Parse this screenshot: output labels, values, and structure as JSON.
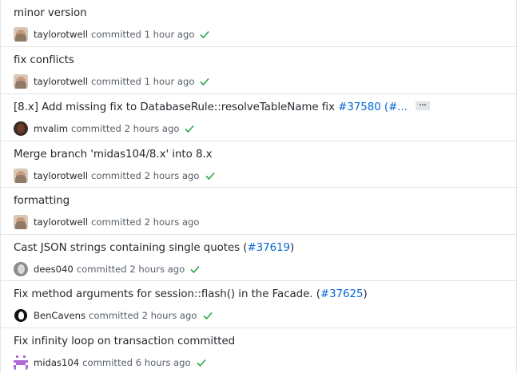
{
  "colors": {
    "check": "#28a745",
    "link": "#0366d6",
    "border": "#e1e4e8",
    "meta_text": "#586069"
  },
  "commits": [
    {
      "title": "minor version",
      "author": "taylorotwell",
      "committed_label": "committed",
      "time": "1 hour ago",
      "avatar": "taylorotwell-avatar",
      "status": "success"
    },
    {
      "title": "fix conflicts",
      "author": "taylorotwell",
      "committed_label": "committed",
      "time": "1 hour ago",
      "avatar": "taylorotwell-avatar",
      "status": "success"
    },
    {
      "title_prefix": "[8.x] Add missing fix to DatabaseRule::resolveTableName fix ",
      "issue_link": "#37580",
      "title_suffix": " (#...",
      "ellipsis": "…",
      "author": "mvalim",
      "committed_label": "committed",
      "time": "2 hours ago",
      "avatar": "mvalim-avatar",
      "status": "success"
    },
    {
      "title": "Merge branch 'midas104/8.x' into 8.x",
      "author": "taylorotwell",
      "committed_label": "committed",
      "time": "2 hours ago",
      "avatar": "taylorotwell-avatar",
      "status": "success"
    },
    {
      "title": "formatting",
      "author": "taylorotwell",
      "committed_label": "committed",
      "time": "2 hours ago",
      "avatar": "taylorotwell-avatar",
      "status": "none"
    },
    {
      "title_prefix": "Cast JSON strings containing single quotes (",
      "issue_link": "#37619",
      "title_suffix": ")",
      "author": "dees040",
      "committed_label": "committed",
      "time": "2 hours ago",
      "avatar": "dees040-avatar",
      "status": "success"
    },
    {
      "title_prefix": "Fix method arguments for session::flash() in the Facade. (",
      "issue_link": "#37625",
      "title_suffix": ")",
      "author": "BenCavens",
      "committed_label": "committed",
      "time": "2 hours ago",
      "avatar": "bencavens-avatar",
      "status": "success"
    },
    {
      "title": "Fix infinity loop on transaction committed",
      "author": "midas104",
      "committed_label": "committed",
      "time": "6 hours ago",
      "avatar": "midas104-avatar",
      "status": "success"
    }
  ]
}
